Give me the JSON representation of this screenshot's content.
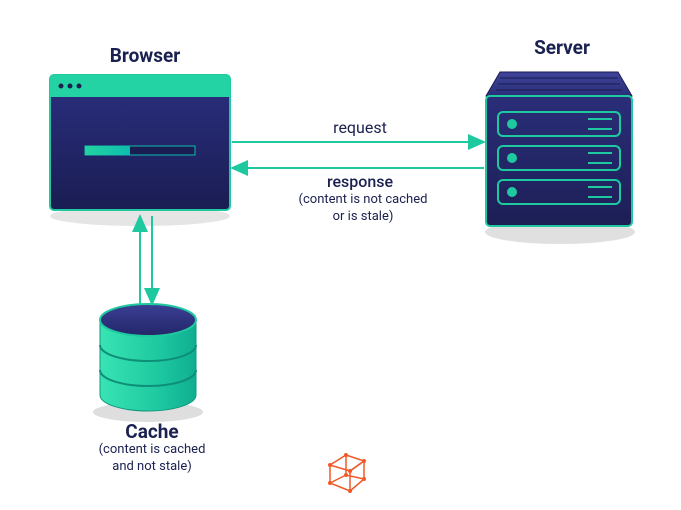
{
  "browser": {
    "title": "Browser"
  },
  "server": {
    "title": "Server"
  },
  "cache": {
    "title": "Cache",
    "subtitle": "(content is cached\nand not stale)"
  },
  "arrows": {
    "request": "request",
    "response": "response",
    "response_note": "(content is not cached\nor is stale)"
  }
}
